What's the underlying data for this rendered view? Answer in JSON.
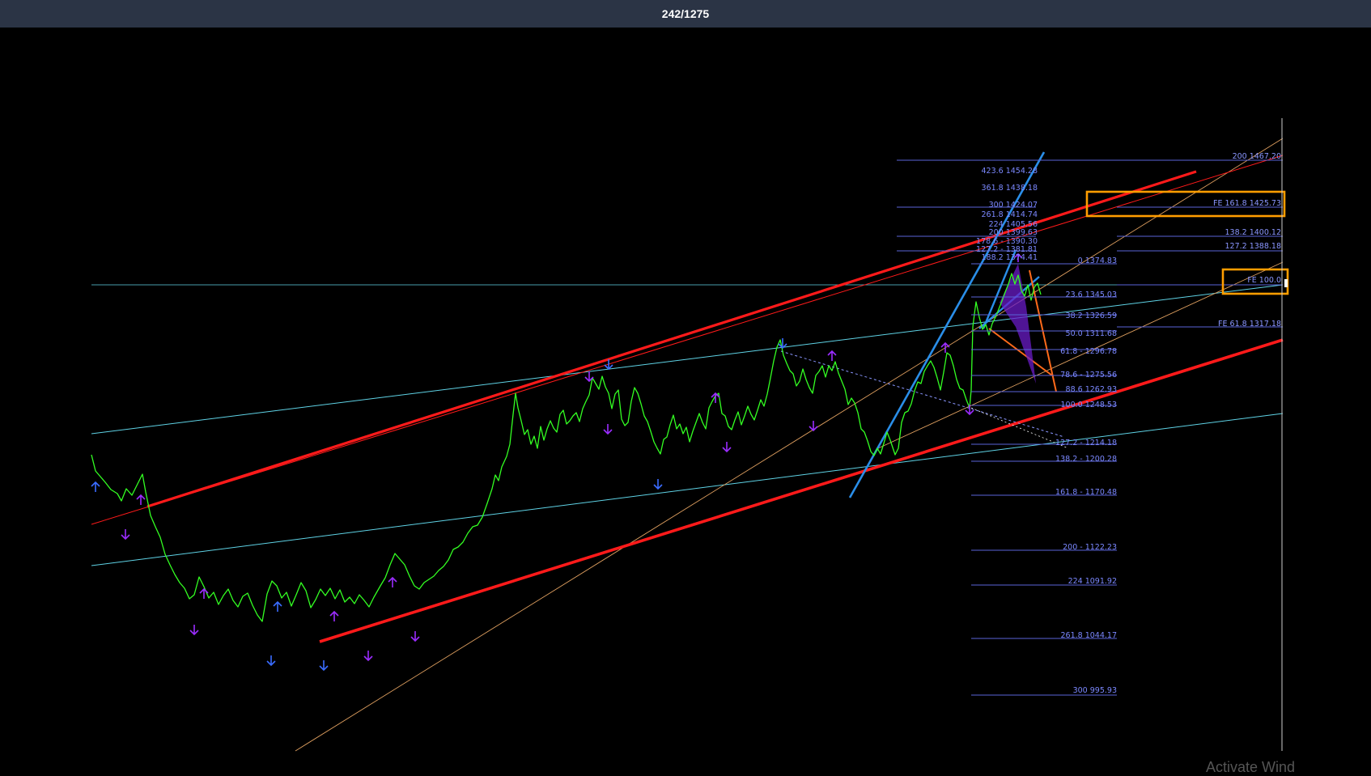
{
  "viewer": {
    "counter": "242/1275"
  },
  "chart": {
    "colors": {
      "background": "#000000",
      "price": "#33ff22",
      "channel": "#ff1a1a",
      "cyan_line": "#5fd3e6",
      "tan_line": "#e0a060",
      "fib_level": "#5a64d8",
      "fib_text": "#7b88ff",
      "blue_trend": "#2a8ee8",
      "orange_trend": "#ff6a1a",
      "highlight_box": "#ff9d00",
      "arrow_purple": "#9b2cff",
      "arrow_blue": "#3a6cff"
    },
    "fib_center": [
      "423.6 1454.28",
      "361.8 1438.18",
      "300 1424.07",
      "261.8 1414.74",
      "224 1405.56",
      "200 1399.63",
      "178.6 - 1390.30",
      "127.2 - 1381.81",
      "188.2 1374.41"
    ],
    "fib_right": [
      "0 1374.83",
      "23.6 1345.03",
      "38.2 1326.59",
      "50.0 1311.68",
      "61.8 - 1296.78",
      "78.6 - 1275.56",
      "88.6 1262.93",
      "100.0 1248.53"
    ],
    "fib_extension": [
      "127.2 - 1214.18",
      "138.2 - 1200.28",
      "161.8 - 1170.48",
      "200 - 1122.23",
      "224 1091.92",
      "261.8 1044.17",
      "300 995.93"
    ],
    "fe_levels": [
      "200 1467.20",
      "FE 161.8 1425.73",
      "138.2 1400.12",
      "127.2 1388.18",
      "FE 100.0",
      "FE 61.8 1317.18"
    ]
  },
  "watermark": "Activate Wind"
}
